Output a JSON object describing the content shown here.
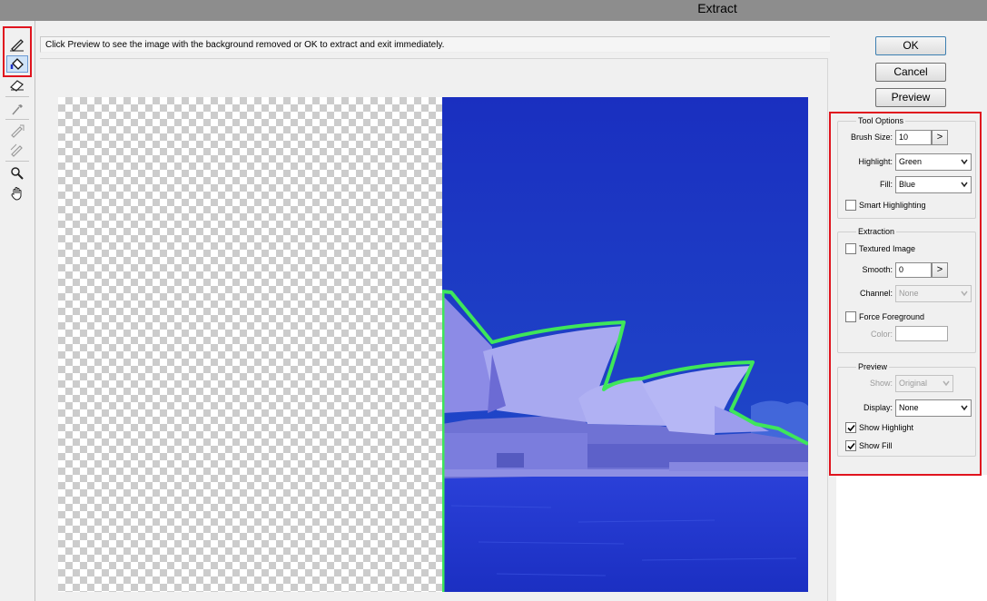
{
  "window": {
    "title": "Extract"
  },
  "instruction": {
    "text": "Click Preview to see the image with the background removed or OK to extract and exit immediately."
  },
  "toolbar": {
    "tools": [
      {
        "icon": "edge-highlighter-icon",
        "active": false
      },
      {
        "icon": "fill-bucket-icon",
        "active": true
      },
      {
        "icon": "eraser-icon",
        "active": false
      },
      {
        "icon": "eyedropper-icon",
        "active": false
      },
      {
        "icon": "cleanup-tool-icon",
        "active": false
      },
      {
        "icon": "edge-touchup-icon",
        "active": false
      },
      {
        "icon": "zoom-icon",
        "active": false
      },
      {
        "icon": "hand-icon",
        "active": false
      }
    ]
  },
  "buttons": {
    "ok": "OK",
    "cancel": "Cancel",
    "preview": "Preview"
  },
  "tool_options": {
    "title": "Tool Options",
    "brush_size_label": "Brush Size:",
    "brush_size_value": "10",
    "stepper_glyph": ">",
    "highlight_label": "Highlight:",
    "highlight_value": "Green",
    "fill_label": "Fill:",
    "fill_value": "Blue",
    "smart_highlighting_label": "Smart Highlighting",
    "smart_highlighting_checked": false
  },
  "extraction": {
    "title": "Extraction",
    "textured_image_label": "Textured Image",
    "textured_image_checked": false,
    "smooth_label": "Smooth:",
    "smooth_value": "0",
    "channel_label": "Channel:",
    "channel_value": "None",
    "force_foreground_label": "Force Foreground",
    "force_foreground_checked": false,
    "color_label": "Color:"
  },
  "preview": {
    "title": "Preview",
    "show_label": "Show:",
    "show_value": "Original",
    "display_label": "Display:",
    "display_value": "None",
    "show_highlight_label": "Show Highlight",
    "show_highlight_checked": true,
    "show_fill_label": "Show Fill",
    "show_fill_checked": true
  },
  "colors": {
    "fill": "#1c2fc4",
    "highlight": "#3ee65a",
    "annotation": "#e0141e"
  }
}
